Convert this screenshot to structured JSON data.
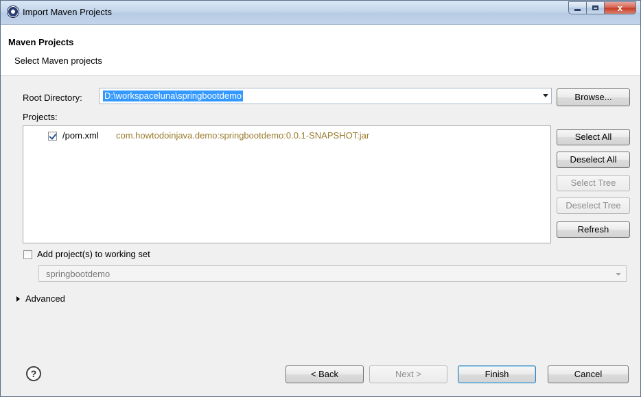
{
  "window": {
    "title": "Import Maven Projects",
    "minimize_glyph": "",
    "close_glyph": "x"
  },
  "header": {
    "title": "Maven Projects",
    "description": "Select Maven projects"
  },
  "root_directory": {
    "label": "Root Directory:",
    "value": "D:\\workspaceluna\\springbootdemo",
    "browse_label": "Browse..."
  },
  "projects": {
    "label": "Projects:",
    "items": [
      {
        "checked": true,
        "path": "/pom.xml",
        "coordinates": "com.howtodoinjava.demo:springbootdemo:0.0.1-SNAPSHOT:jar"
      }
    ],
    "buttons": {
      "select_all": "Select All",
      "deselect_all": "Deselect All",
      "select_tree": "Select Tree",
      "deselect_tree": "Deselect Tree",
      "refresh": "Refresh"
    }
  },
  "working_set": {
    "checkbox_label": "Add project(s) to working set",
    "checked": false,
    "value": "springbootdemo"
  },
  "advanced": {
    "label": "Advanced"
  },
  "footer": {
    "help_symbol": "?",
    "back_label": "< Back",
    "next_label": "Next >",
    "finish_label": "Finish",
    "cancel_label": "Cancel"
  },
  "colors": {
    "selection": "#3399ff",
    "coordinates_text": "#9a7b2d",
    "disabled_text": "#8e8e8e"
  }
}
